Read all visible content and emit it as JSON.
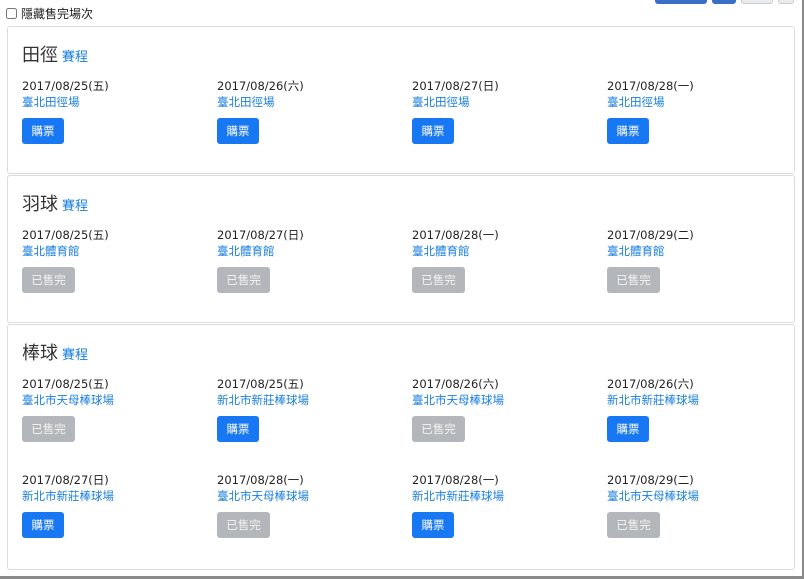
{
  "filter": {
    "hide_sold_out_label": "隱藏售完場次",
    "checked": false
  },
  "sports": [
    {
      "name": "田徑",
      "schedule_label": "賽程",
      "rows": [
        [
          {
            "date": "2017/08/25(五)",
            "venue": "臺北田徑場",
            "status": "buy",
            "button": "購票"
          },
          {
            "date": "2017/08/26(六)",
            "venue": "臺北田徑場",
            "status": "buy",
            "button": "購票"
          },
          {
            "date": "2017/08/27(日)",
            "venue": "臺北田徑場",
            "status": "buy",
            "button": "購票"
          },
          {
            "date": "2017/08/28(一)",
            "venue": "臺北田徑場",
            "status": "buy",
            "button": "購票"
          }
        ]
      ]
    },
    {
      "name": "羽球",
      "schedule_label": "賽程",
      "rows": [
        [
          {
            "date": "2017/08/25(五)",
            "venue": "臺北體育館",
            "status": "sold",
            "button": "已售完"
          },
          {
            "date": "2017/08/27(日)",
            "venue": "臺北體育館",
            "status": "sold",
            "button": "已售完"
          },
          {
            "date": "2017/08/28(一)",
            "venue": "臺北體育館",
            "status": "sold",
            "button": "已售完"
          },
          {
            "date": "2017/08/29(二)",
            "venue": "臺北體育館",
            "status": "sold",
            "button": "已售完"
          }
        ]
      ]
    },
    {
      "name": "棒球",
      "schedule_label": "賽程",
      "rows": [
        [
          {
            "date": "2017/08/25(五)",
            "venue": "臺北市天母棒球場",
            "status": "sold",
            "button": "已售完"
          },
          {
            "date": "2017/08/25(五)",
            "venue": "新北市新莊棒球場",
            "status": "buy",
            "button": "購票"
          },
          {
            "date": "2017/08/26(六)",
            "venue": "臺北市天母棒球場",
            "status": "sold",
            "button": "已售完"
          },
          {
            "date": "2017/08/26(六)",
            "venue": "新北市新莊棒球場",
            "status": "buy",
            "button": "購票"
          }
        ],
        [
          {
            "date": "2017/08/27(日)",
            "venue": "新北市新莊棒球場",
            "status": "buy",
            "button": "購票"
          },
          {
            "date": "2017/08/28(一)",
            "venue": "臺北市天母棒球場",
            "status": "sold",
            "button": "已售完"
          },
          {
            "date": "2017/08/28(一)",
            "venue": "新北市新莊棒球場",
            "status": "buy",
            "button": "購票"
          },
          {
            "date": "2017/08/29(二)",
            "venue": "臺北市天母棒球場",
            "status": "sold",
            "button": "已售完"
          }
        ]
      ]
    }
  ]
}
